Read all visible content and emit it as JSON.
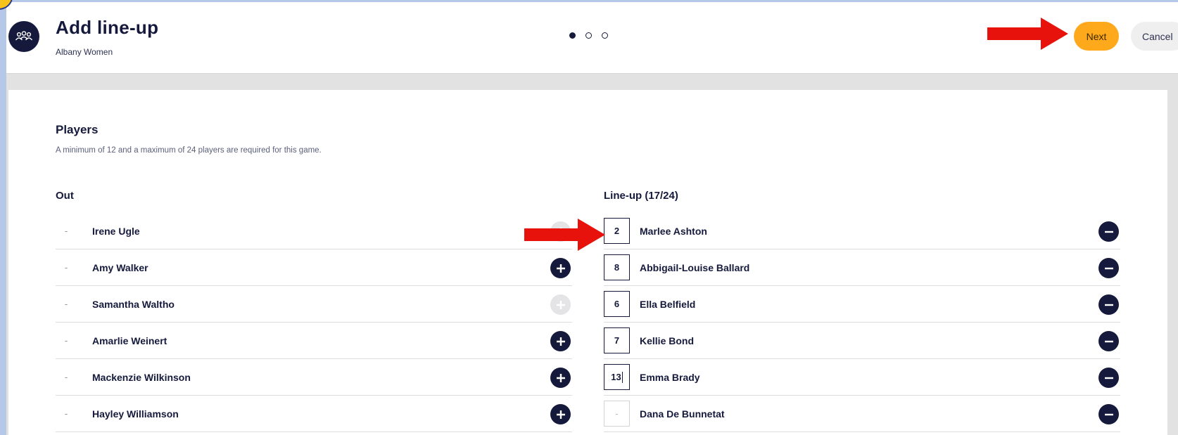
{
  "header": {
    "title": "Add line-up",
    "subtitle": "Albany Women",
    "next_label": "Next",
    "cancel_label": "Cancel",
    "step_total": 3,
    "step_current": 1
  },
  "players": {
    "title": "Players",
    "description": "A minimum of 12 and a maximum of 24 players are required for this game.",
    "out_title": "Out",
    "lineup_title": "Line-up (17/24)",
    "out": [
      {
        "dash": "-",
        "name": "Irene Ugle",
        "add_enabled": false
      },
      {
        "dash": "-",
        "name": "Amy Walker",
        "add_enabled": true
      },
      {
        "dash": "-",
        "name": "Samantha Waltho",
        "add_enabled": false
      },
      {
        "dash": "-",
        "name": "Amarlie Weinert",
        "add_enabled": true
      },
      {
        "dash": "-",
        "name": "Mackenzie Wilkinson",
        "add_enabled": true
      },
      {
        "dash": "-",
        "name": "Hayley Williamson",
        "add_enabled": true
      }
    ],
    "lineup": [
      {
        "number": "2",
        "name": "Marlee Ashton"
      },
      {
        "number": "8",
        "name": "Abbigail-Louise Ballard"
      },
      {
        "number": "6",
        "name": "Ella Belfield"
      },
      {
        "number": "7",
        "name": "Kellie Bond"
      },
      {
        "number": "13",
        "name": "Emma Brady"
      },
      {
        "number": "-",
        "name": "Dana De Bunnetat"
      }
    ]
  },
  "colors": {
    "navy": "#151a3c",
    "next_button": "#fea81c",
    "annotation_arrow": "#e8120c"
  }
}
